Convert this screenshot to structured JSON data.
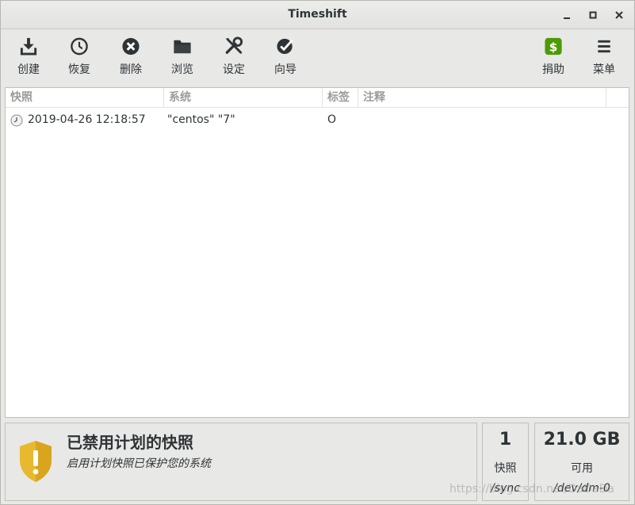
{
  "window": {
    "title": "Timeshift"
  },
  "toolbar": {
    "create": "创建",
    "restore": "恢复",
    "delete": "删除",
    "browse": "浏览",
    "settings": "设定",
    "wizard": "向导",
    "donate": "捐助",
    "menu": "菜单",
    "donate_icon_color": "#4e9a06"
  },
  "table": {
    "columns": [
      "快照",
      "系统",
      "标签",
      "注释"
    ],
    "rows": [
      {
        "snapshot": "2019-04-26 12:18:57",
        "system": "\"centos\" \"7\"",
        "tags": "O",
        "comment": ""
      }
    ]
  },
  "status": {
    "title": "已禁用计划的快照",
    "subtitle": "启用计划快照已保护您的系统",
    "shield_color": "#e8b82e"
  },
  "stats": {
    "snapshots_count": "1",
    "snapshots_label": "快照",
    "snapshots_path": "/sync",
    "free_value": "21.0 GB",
    "free_label": "可用",
    "free_device": "/dev/dm-0"
  },
  "watermark": "https://blog.csdn.net/DaDaDa"
}
